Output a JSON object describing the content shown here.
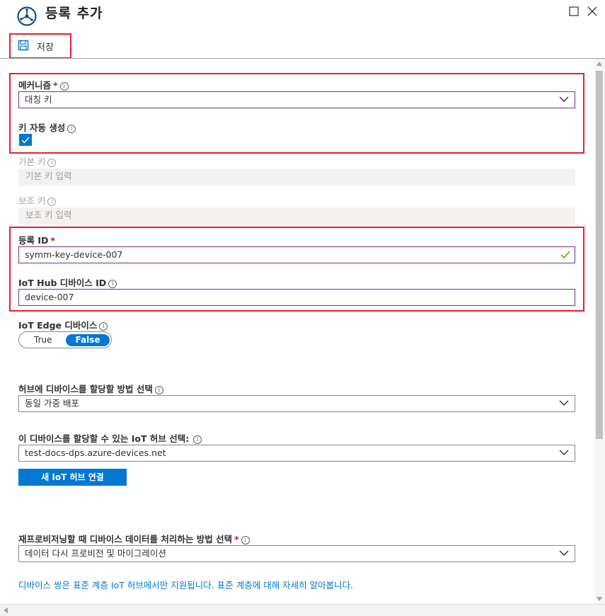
{
  "header": {
    "title": "등록 추가"
  },
  "toolbar": {
    "save_label": "저장"
  },
  "form": {
    "mechanism": {
      "label": "메커니즘",
      "required": "*",
      "value": "대칭 키"
    },
    "auto_generate": {
      "label": "키 자동 생성",
      "checked": true
    },
    "primary_key": {
      "label": "기본 키",
      "placeholder": "기본 키 입력"
    },
    "secondary_key": {
      "label": "보조 키",
      "placeholder": "보조 키 입력"
    },
    "registration_id": {
      "label": "등록 ID",
      "required": "*",
      "value": "symm-key-device-007"
    },
    "iot_hub_device_id": {
      "label": "IoT Hub 디바이스 ID",
      "value": "device-007"
    },
    "iot_edge": {
      "label": "IoT Edge 디바이스",
      "true_label": "True",
      "false_label": "False",
      "selected": "False"
    },
    "assign_method": {
      "label": "허브에 디바이스를 할당할 방법 선택",
      "value": "동일 가중 배포"
    },
    "assign_hub": {
      "label": "이 디바이스를 할당할 수 있는 IoT 허브 선택:",
      "value": "test-docs-dps.azure-devices.net"
    },
    "link_hub_button": "새 IoT 허브 연결",
    "reprovision": {
      "label": "재프로비저닝할 때 디바이스 데이터를 처리하는 방법 선택",
      "required": "*",
      "value": "데이터 다시 프로비전 및 마이그레이션"
    },
    "note": "디바이스 쌍은 표준 계층 IoT 허브에서만 지원됩니다. 표준 계층에 대해 자세히 알아봅니다."
  },
  "colors": {
    "accent": "#0078d4",
    "highlight": "#e8202a",
    "focus_border": "#7b2e8c",
    "success": "#57a300"
  }
}
